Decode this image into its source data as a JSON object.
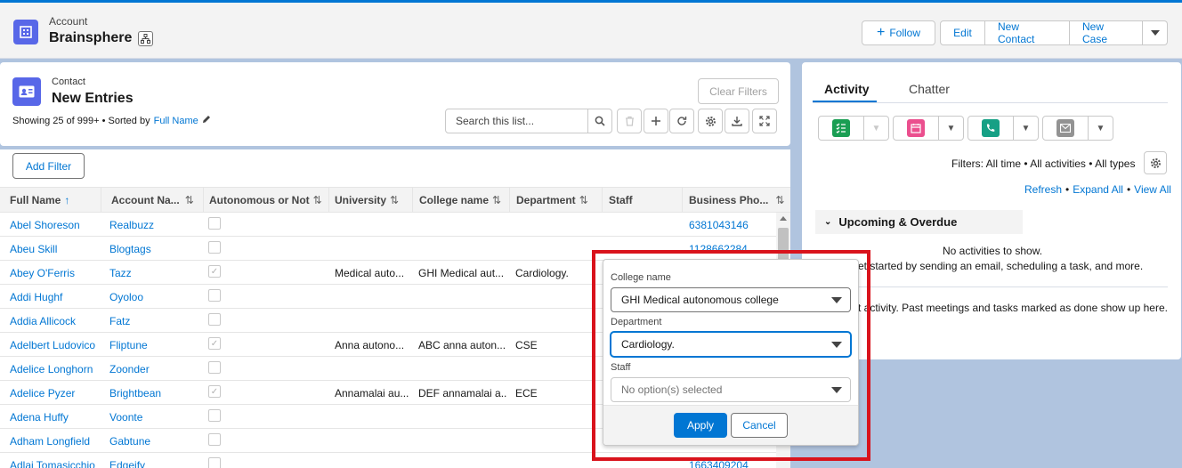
{
  "header": {
    "object_type": "Account",
    "record_name": "Brainsphere",
    "buttons": {
      "follow": "Follow",
      "edit": "Edit",
      "new_contact": "New Contact",
      "new_case": "New Case"
    },
    "follow_prefix": "+"
  },
  "list": {
    "object_type": "Contact",
    "title": "New Entries",
    "meta_prefix": "Showing 25 of 999+ • Sorted by",
    "meta_sort_field": "Full Name",
    "clear_filters": "Clear Filters",
    "search_placeholder": "Search this list...",
    "add_filter": "Add Filter",
    "columns": [
      "Full Name",
      "Account Na...",
      "Autonomous or Not",
      "University",
      "College name",
      "Department",
      "Staff",
      "Business Pho..."
    ],
    "rows": [
      {
        "name": "Abel Shoreson",
        "account": "Realbuzz",
        "checked": false,
        "university": "",
        "college": "",
        "department": "",
        "phone": "6381043146"
      },
      {
        "name": "Abeu Skill",
        "account": "Blogtags",
        "checked": false,
        "university": "",
        "college": "",
        "department": "",
        "phone": "1128662284"
      },
      {
        "name": "Abey O'Ferris",
        "account": "Tazz",
        "checked": true,
        "university": "Medical auto...",
        "college": "GHI Medical aut...",
        "department": "Cardiology.",
        "phone": ""
      },
      {
        "name": "Addi Hughf",
        "account": "Oyoloo",
        "checked": false,
        "university": "",
        "college": "",
        "department": "",
        "phone": ""
      },
      {
        "name": "Addia Allicock",
        "account": "Fatz",
        "checked": false,
        "university": "",
        "college": "",
        "department": "",
        "phone": ""
      },
      {
        "name": "Adelbert Ludovico",
        "account": "Fliptune",
        "checked": true,
        "university": "Anna autono...",
        "college": "ABC anna auton...",
        "department": "CSE",
        "phone": ""
      },
      {
        "name": "Adelice Longhorn",
        "account": "Zoonder",
        "checked": false,
        "university": "",
        "college": "",
        "department": "",
        "phone": ""
      },
      {
        "name": "Adelice Pyzer",
        "account": "Brightbean",
        "checked": true,
        "university": "Annamalai au...",
        "college": "DEF annamalai a...",
        "department": "ECE",
        "phone": ""
      },
      {
        "name": "Adena Huffy",
        "account": "Voonte",
        "checked": false,
        "university": "",
        "college": "",
        "department": "",
        "phone": ""
      },
      {
        "name": "Adham Longfield",
        "account": "Gabtune",
        "checked": false,
        "university": "",
        "college": "",
        "department": "",
        "phone": ""
      },
      {
        "name": "Adlai Tomasicchio",
        "account": "Edgeify",
        "checked": false,
        "university": "",
        "college": "",
        "department": "",
        "phone": "1663409204"
      }
    ]
  },
  "popover": {
    "college_label": "College name",
    "college_value": "GHI Medical autonomous college",
    "department_label": "Department",
    "department_value": "Cardiology.",
    "staff_label": "Staff",
    "staff_placeholder": "No option(s) selected",
    "apply": "Apply",
    "cancel": "Cancel"
  },
  "activity": {
    "tabs": [
      "Activity",
      "Chatter"
    ],
    "filters_text": "Filters: All time • All activities • All types",
    "links": [
      "Refresh",
      "Expand All",
      "View All"
    ],
    "separator": "•",
    "upcoming": "Upcoming & Overdue",
    "no_activities": "No activities to show.",
    "get_started": "Get started by sending an email, scheduling a task, and more.",
    "get_started_visible": "et started by sending an email, scheduling a task, and more.",
    "past_activity": "No past activity. Past meetings and tasks marked as done show up here.",
    "past_activity_visible": "t activity. Past meetings and tasks marked as done show up here."
  },
  "colors": {
    "brand": "#0176d3",
    "account_icon": "#5867e8",
    "task": "#1a9e53",
    "event": "#eb4f8e",
    "call": "#16a085",
    "email": "#939393",
    "highlight": "#d9131c"
  }
}
